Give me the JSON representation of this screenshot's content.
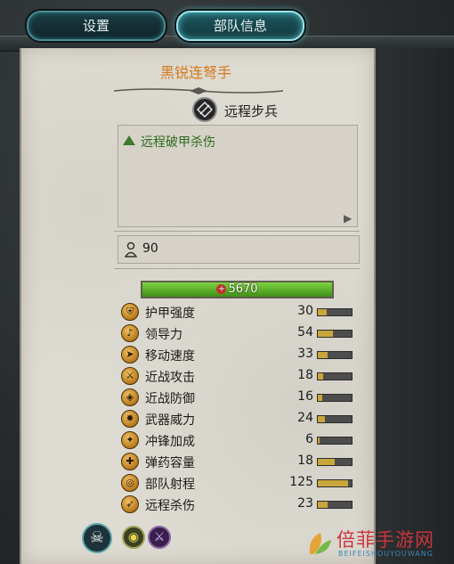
{
  "tabs": [
    {
      "label": "设置"
    },
    {
      "label": "部队信息"
    }
  ],
  "unit": {
    "name": "黑锐连弩手",
    "class_icon": "arrow-target-icon",
    "class_label": "远程步兵",
    "ability": "远程破甲杀伤",
    "men": "90",
    "health_display": "5670",
    "health_fraction": 1.0
  },
  "stats": [
    {
      "label": "护甲强度",
      "value": "30",
      "icon": "armor-icon",
      "fill": 0.25
    },
    {
      "label": "领导力",
      "value": "54",
      "icon": "horn-icon",
      "fill": 0.45
    },
    {
      "label": "移动速度",
      "value": "33",
      "icon": "speed-icon",
      "fill": 0.3
    },
    {
      "label": "近战攻击",
      "value": "18",
      "icon": "sword-icon",
      "fill": 0.15
    },
    {
      "label": "近战防御",
      "value": "16",
      "icon": "shield-icon",
      "fill": 0.14
    },
    {
      "label": "武器威力",
      "value": "24",
      "icon": "burst-icon",
      "fill": 0.22
    },
    {
      "label": "冲锋加成",
      "value": "6",
      "icon": "charge-icon",
      "fill": 0.05
    },
    {
      "label": "弹药容量",
      "value": "18",
      "icon": "ammo-icon",
      "fill": 0.5
    },
    {
      "label": "部队射程",
      "value": "125",
      "icon": "range-target-icon",
      "fill": 0.9
    },
    {
      "label": "远程杀伤",
      "value": "23",
      "icon": "ranged-damage-icon",
      "fill": 0.3
    }
  ],
  "bottom_icons": [
    "skull-icon",
    "eye-icon",
    "claw-icon"
  ],
  "watermark": {
    "title": "倍菲手游网",
    "sub": "BEIFEISHOUYOUWANG"
  },
  "colors": {
    "unit_name": "#d4791a",
    "ability": "#2e6b21",
    "health": "#5fb82c",
    "tab_border": "#9fe3e8"
  }
}
